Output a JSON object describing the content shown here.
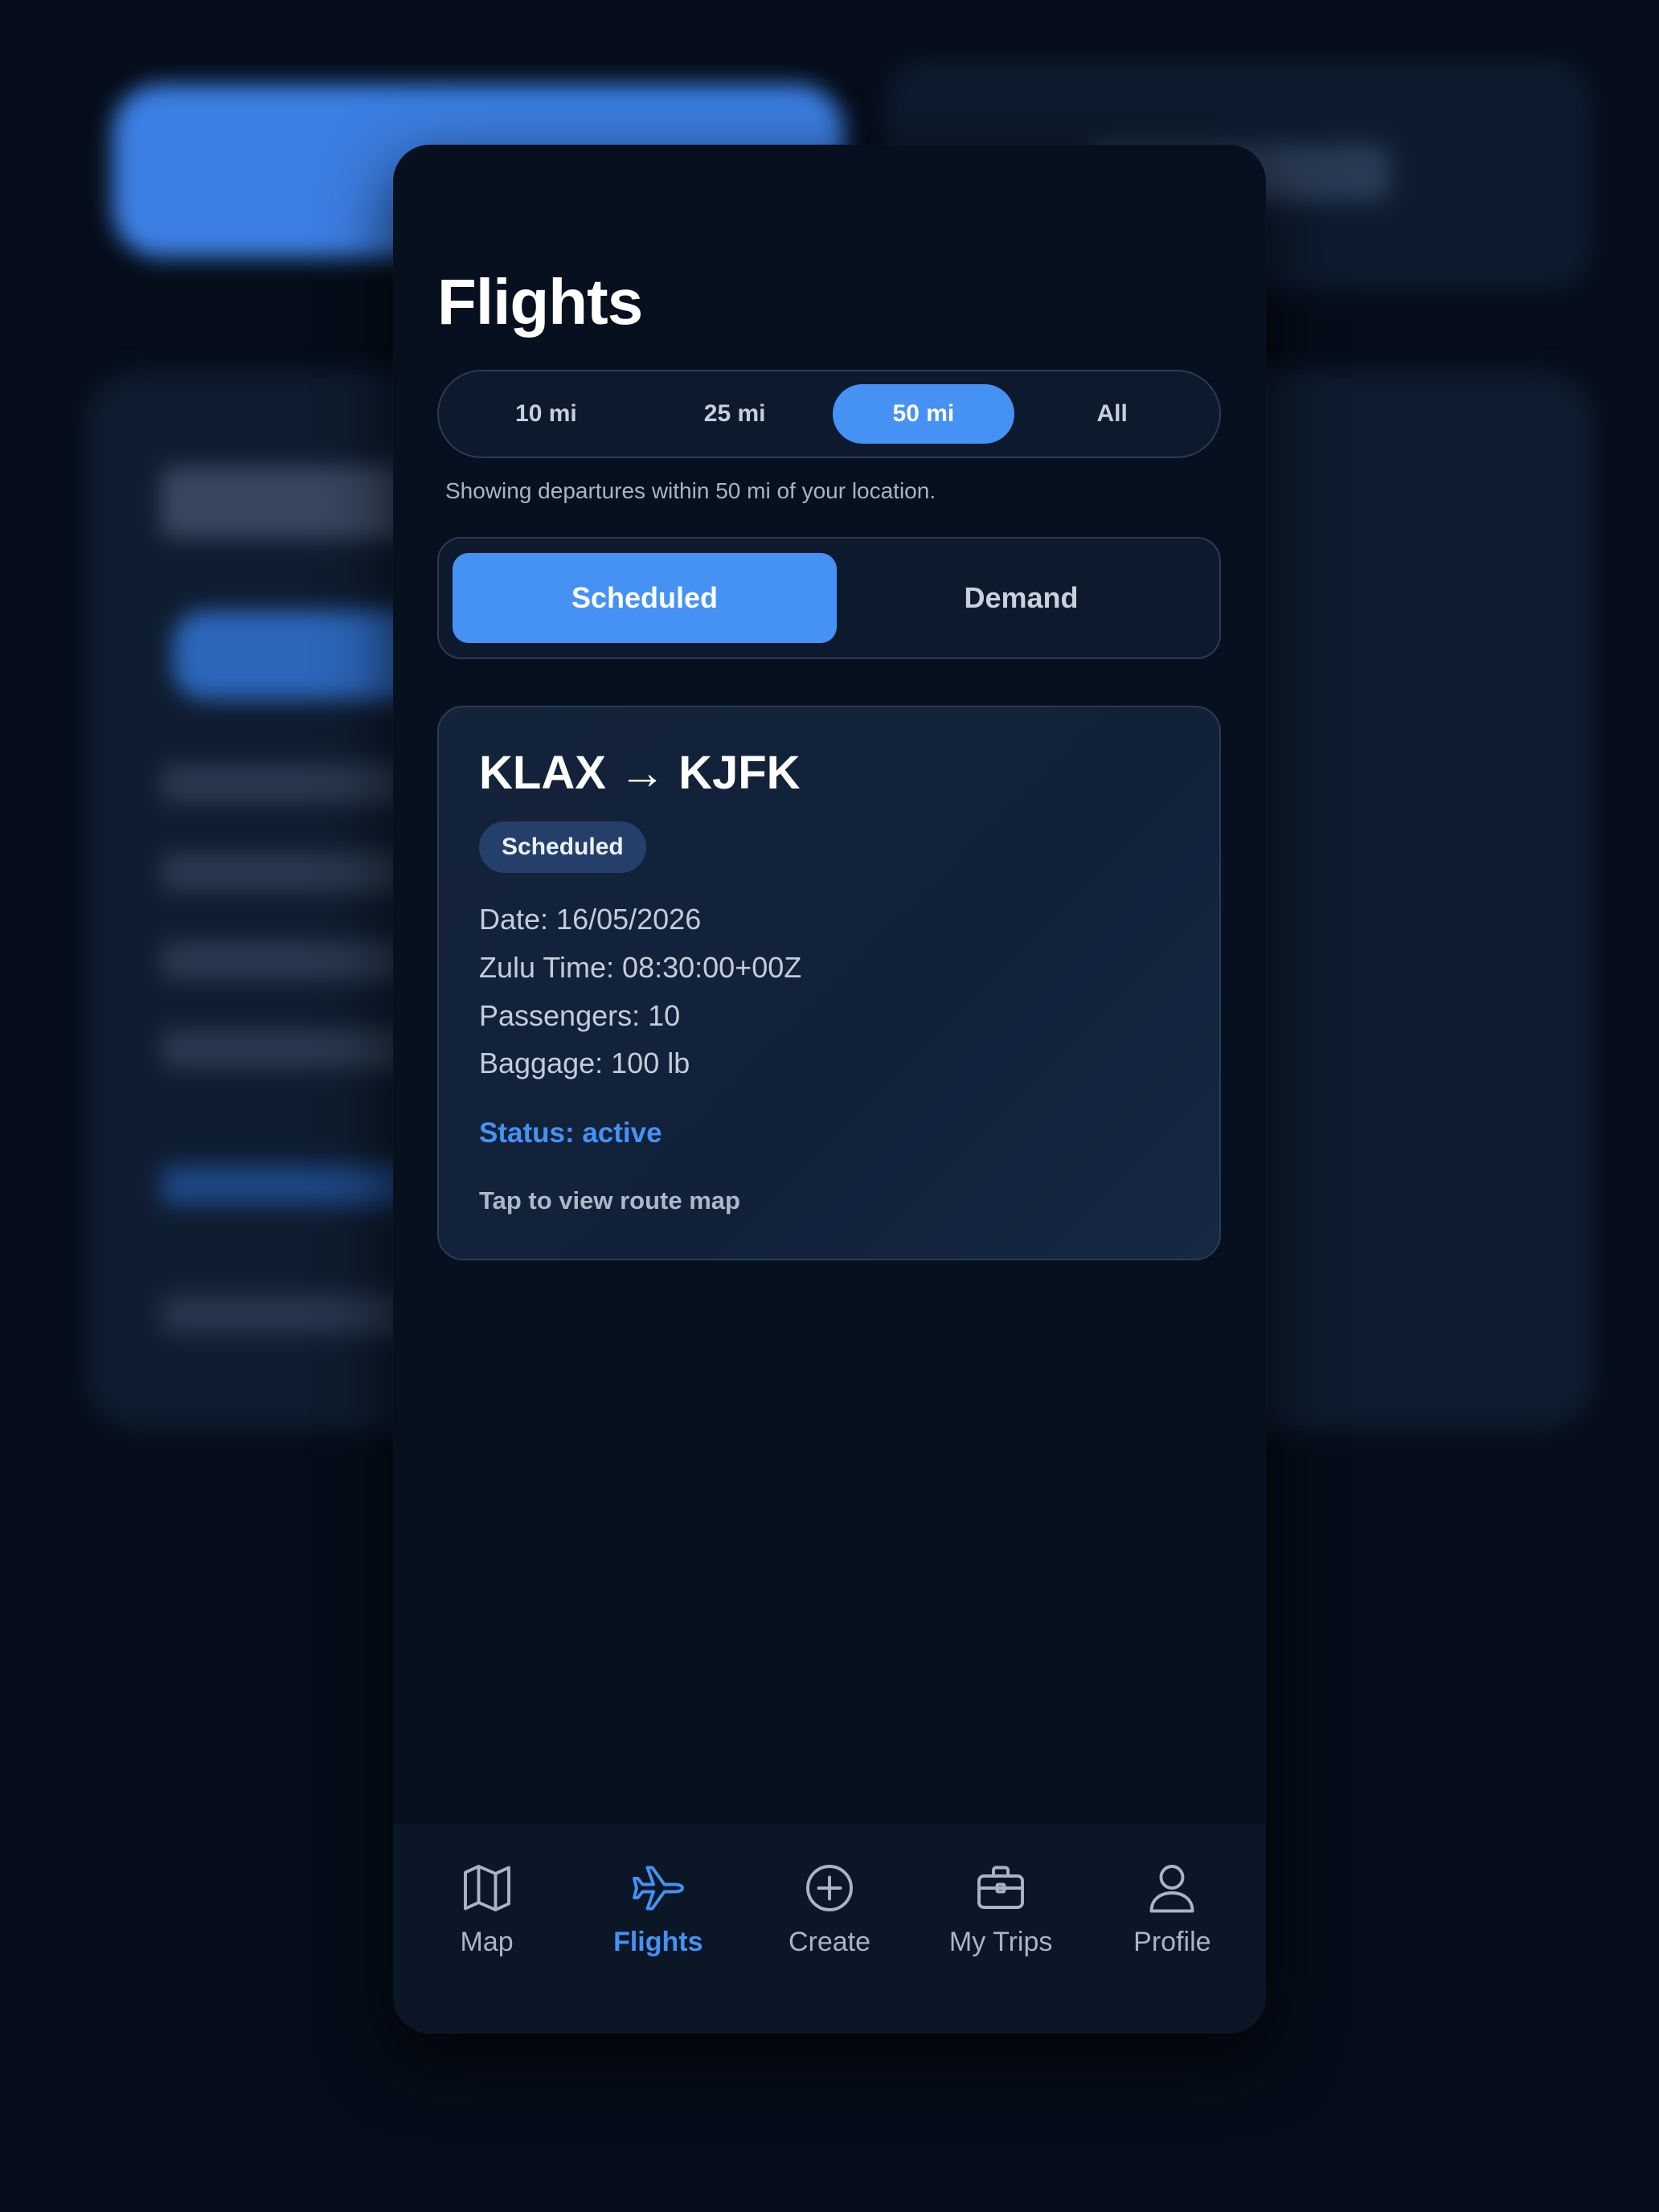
{
  "page": {
    "title": "Flights"
  },
  "range_filter": {
    "options": [
      "10 mi",
      "25 mi",
      "50 mi",
      "All"
    ],
    "selected": "50 mi"
  },
  "hint_text": "Showing departures within 50 mi of your location.",
  "mode_toggle": {
    "options": [
      "Scheduled",
      "Demand"
    ],
    "selected": "Scheduled"
  },
  "flight": {
    "route": "KLAX → KJFK",
    "badge": "Scheduled",
    "date": "Date: 16/05/2026",
    "zulu_time": "Zulu Time: 08:30:00+00Z",
    "passengers": "Passengers: 10",
    "baggage": "Baggage: 100 lb",
    "status": "Status: active",
    "tap_hint": "Tap to view route map"
  },
  "tabbar": {
    "items": [
      {
        "label": "Map",
        "icon": "map-icon"
      },
      {
        "label": "Flights",
        "icon": "airplane-icon"
      },
      {
        "label": "Create",
        "icon": "plus-circle-icon"
      },
      {
        "label": "My Trips",
        "icon": "briefcase-icon"
      },
      {
        "label": "Profile",
        "icon": "user-icon"
      }
    ],
    "active": "Flights"
  },
  "colors": {
    "accent": "#4592f4",
    "background": "#06101f",
    "card": "#12213a"
  }
}
